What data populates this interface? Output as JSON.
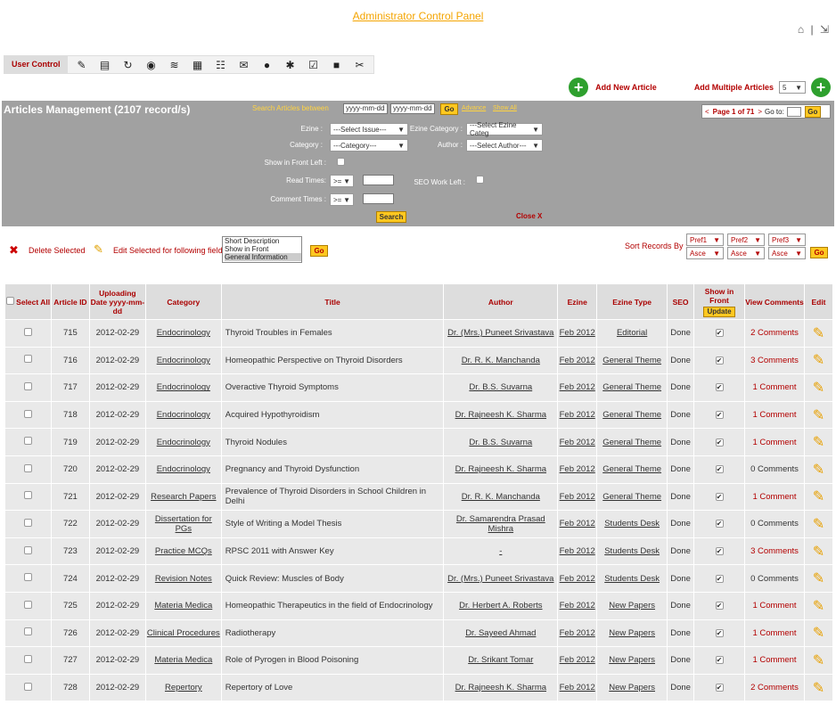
{
  "header": {
    "title": "Administrator Control Panel"
  },
  "toolbar": {
    "user_control": "User Control",
    "icons": [
      "notes-icon",
      "book-icon",
      "refresh-icon",
      "globe-icon",
      "layers-icon",
      "document-icon",
      "users-icon",
      "envelope-icon",
      "coins-icon",
      "gear-icon",
      "checklist-icon",
      "bus-icon",
      "tools-icon"
    ]
  },
  "add": {
    "add_new": "Add New Article",
    "add_multiple": "Add Multiple Articles",
    "count": "5"
  },
  "panel": {
    "title": "Articles Management (2107 record/s)",
    "search_between": "Search Articles between",
    "date_from": "yyyy-mm-dd",
    "date_to": "yyyy-mm-dd",
    "go": "Go",
    "advance": "Advance",
    "show_all": "Show All",
    "ezine_label": "Ezine :",
    "ezine_value": "---Select Issue---",
    "ezine_cat_label": "Ezine Category :",
    "ezine_cat_value": "---Select Ezine Categ",
    "category_label": "Category :",
    "category_value": "---Category---",
    "author_label": "Author :",
    "author_value": "---Select Author---",
    "show_front_label": "Show in Front Left :",
    "read_times_label": "Read Times:",
    "read_op": ">=",
    "seo_label": "SEO Work Left :",
    "comment_times_label": "Comment Times :",
    "comment_op": ">=",
    "search": "Search",
    "close": "Close X",
    "pager_text": "Page 1 of 71",
    "goto": "Go to:"
  },
  "actions": {
    "delete": "Delete Selected",
    "edit_selected": "Edit Selected for following fields:",
    "fields": [
      "Short Description",
      "Show in Front",
      "General Information"
    ],
    "go": "Go",
    "sort_by": "Sort Records By :",
    "pref1": "Pref1",
    "pref2": "Pref2",
    "pref3": "Pref3",
    "asc": "Asce"
  },
  "table": {
    "headers": {
      "select": "Select All",
      "id": "Article ID",
      "date": "Uploading Date yyyy-mm-dd",
      "category": "Category",
      "title": "Title",
      "author": "Author",
      "ezine": "Ezine",
      "ezine_type": "Ezine Type",
      "seo": "SEO",
      "show_front": "Show in Front",
      "update": "Update",
      "comments": "View Comments",
      "edit": "Edit"
    },
    "rows": [
      {
        "id": "715",
        "date": "2012-02-29",
        "category": "Endocrinology",
        "title": "Thyroid Troubles in Females",
        "author": "Dr. (Mrs.) Puneet Srivastava",
        "ezine": "Feb 2012",
        "type": "Editorial",
        "seo": "Done",
        "comments": "2 Comments"
      },
      {
        "id": "716",
        "date": "2012-02-29",
        "category": "Endocrinology",
        "title": "Homeopathic Perspective on Thyroid Disorders",
        "author": "Dr. R. K. Manchanda",
        "ezine": "Feb 2012",
        "type": "General Theme",
        "seo": "Done",
        "comments": "3 Comments"
      },
      {
        "id": "717",
        "date": "2012-02-29",
        "category": "Endocrinology",
        "title": "Overactive Thyroid Symptoms",
        "author": "Dr. B.S. Suvarna",
        "ezine": "Feb 2012",
        "type": "General Theme",
        "seo": "Done",
        "comments": "1 Comment"
      },
      {
        "id": "718",
        "date": "2012-02-29",
        "category": "Endocrinology",
        "title": "Acquired Hypothyroidism",
        "author": "Dr. Rajneesh K. Sharma",
        "ezine": "Feb 2012",
        "type": "General Theme",
        "seo": "Done",
        "comments": "1 Comment"
      },
      {
        "id": "719",
        "date": "2012-02-29",
        "category": "Endocrinology",
        "title": "Thyroid Nodules",
        "author": "Dr. B.S. Suvarna",
        "ezine": "Feb 2012",
        "type": "General Theme",
        "seo": "Done",
        "comments": "1 Comment"
      },
      {
        "id": "720",
        "date": "2012-02-29",
        "category": "Endocrinology",
        "title": "Pregnancy and Thyroid Dysfunction",
        "author": "Dr. Rajneesh K. Sharma",
        "ezine": "Feb 2012",
        "type": "General Theme",
        "seo": "Done",
        "comments": "0 Comments"
      },
      {
        "id": "721",
        "date": "2012-02-29",
        "category": "Research Papers",
        "title": "Prevalence of Thyroid Disorders in School Children in Delhi",
        "author": "Dr. R. K. Manchanda",
        "ezine": "Feb 2012",
        "type": "General Theme",
        "seo": "Done",
        "comments": "1 Comment"
      },
      {
        "id": "722",
        "date": "2012-02-29",
        "category": "Dissertation for PGs",
        "title": "Style of Writing a Model Thesis",
        "author": "Dr. Samarendra Prasad Mishra",
        "ezine": "Feb 2012",
        "type": "Students Desk",
        "seo": "Done",
        "comments": "0 Comments"
      },
      {
        "id": "723",
        "date": "2012-02-29",
        "category": "Practice MCQs",
        "title": "RPSC 2011 with Answer Key",
        "author": "-",
        "ezine": "Feb 2012",
        "type": "Students Desk",
        "seo": "Done",
        "comments": "3 Comments"
      },
      {
        "id": "724",
        "date": "2012-02-29",
        "category": "Revision Notes",
        "title": "Quick Review: Muscles of Body",
        "author": "Dr. (Mrs.) Puneet Srivastava",
        "ezine": "Feb 2012",
        "type": "Students Desk",
        "seo": "Done",
        "comments": "0 Comments"
      },
      {
        "id": "725",
        "date": "2012-02-29",
        "category": "Materia Medica",
        "title": "Homeopathic Therapeutics in the field of Endocrinology",
        "author": "Dr. Herbert A. Roberts",
        "ezine": "Feb 2012",
        "type": "New Papers",
        "seo": "Done",
        "comments": "1 Comment"
      },
      {
        "id": "726",
        "date": "2012-02-29",
        "category": "Clinical Procedures",
        "title": "Radiotherapy",
        "author": "Dr. Sayeed Ahmad",
        "ezine": "Feb 2012",
        "type": "New Papers",
        "seo": "Done",
        "comments": "1 Comment"
      },
      {
        "id": "727",
        "date": "2012-02-29",
        "category": "Materia Medica",
        "title": "Role of Pyrogen in Blood Poisoning",
        "author": "Dr. Srikant Tomar",
        "ezine": "Feb 2012",
        "type": "New Papers",
        "seo": "Done",
        "comments": "1 Comment"
      },
      {
        "id": "728",
        "date": "2012-02-29",
        "category": "Repertory",
        "title": "Repertory of Love",
        "author": "Dr. Rajneesh K. Sharma",
        "ezine": "Feb 2012",
        "type": "New Papers",
        "seo": "Done",
        "comments": "2 Comments"
      }
    ]
  }
}
